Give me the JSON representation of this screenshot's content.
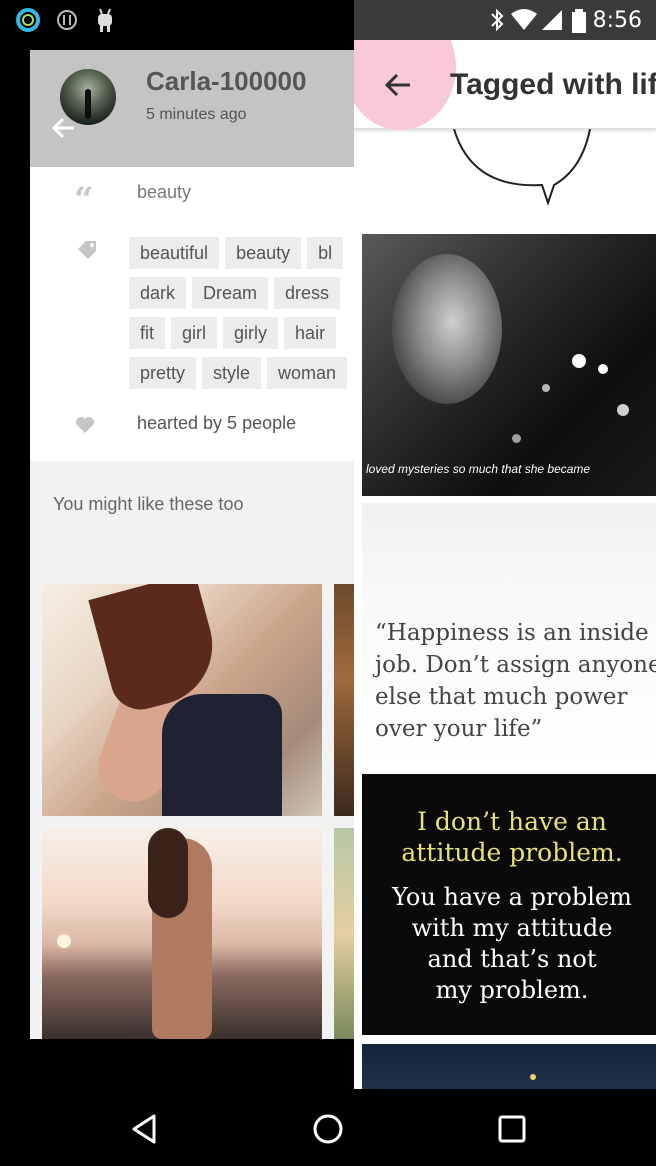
{
  "status_bar": {
    "time": "8:56",
    "left_icons": [
      "circle-ring-icon",
      "info-icon",
      "android-icon"
    ],
    "right_icons": [
      "bluetooth-icon",
      "wifi-icon",
      "signal-icon",
      "battery-icon"
    ]
  },
  "detail": {
    "username": "Carla-100000",
    "timestamp": "5 minutes ago",
    "caption": "beauty",
    "tag_rows": [
      [
        "beautiful",
        "beauty",
        "bl"
      ],
      [
        "dark",
        "Dream",
        "dress"
      ],
      [
        "fit",
        "girl",
        "girly",
        "hair"
      ],
      [
        "pretty",
        "style",
        "woman"
      ]
    ],
    "hearted": "hearted by 5 people",
    "might_like": "You might like these too"
  },
  "tagged": {
    "title": "Tagged with life",
    "image1_caption": "loved mysteries so much that she became",
    "quote": "“Happiness is an inside job. Don’t assign anyone else that much power over your life”",
    "attitude_title": "I don’t have an\nattitude problem.",
    "attitude_body": "You have a problem\nwith my attitude\nand that’s not\nmy problem."
  },
  "colors": {
    "header_gray": "#c4c4c4",
    "ripple_pink": "#f8c9d8",
    "attitude_yellow": "#e8e07a"
  },
  "nav": [
    "back-triangle-icon",
    "home-circle-icon",
    "recents-square-icon"
  ]
}
